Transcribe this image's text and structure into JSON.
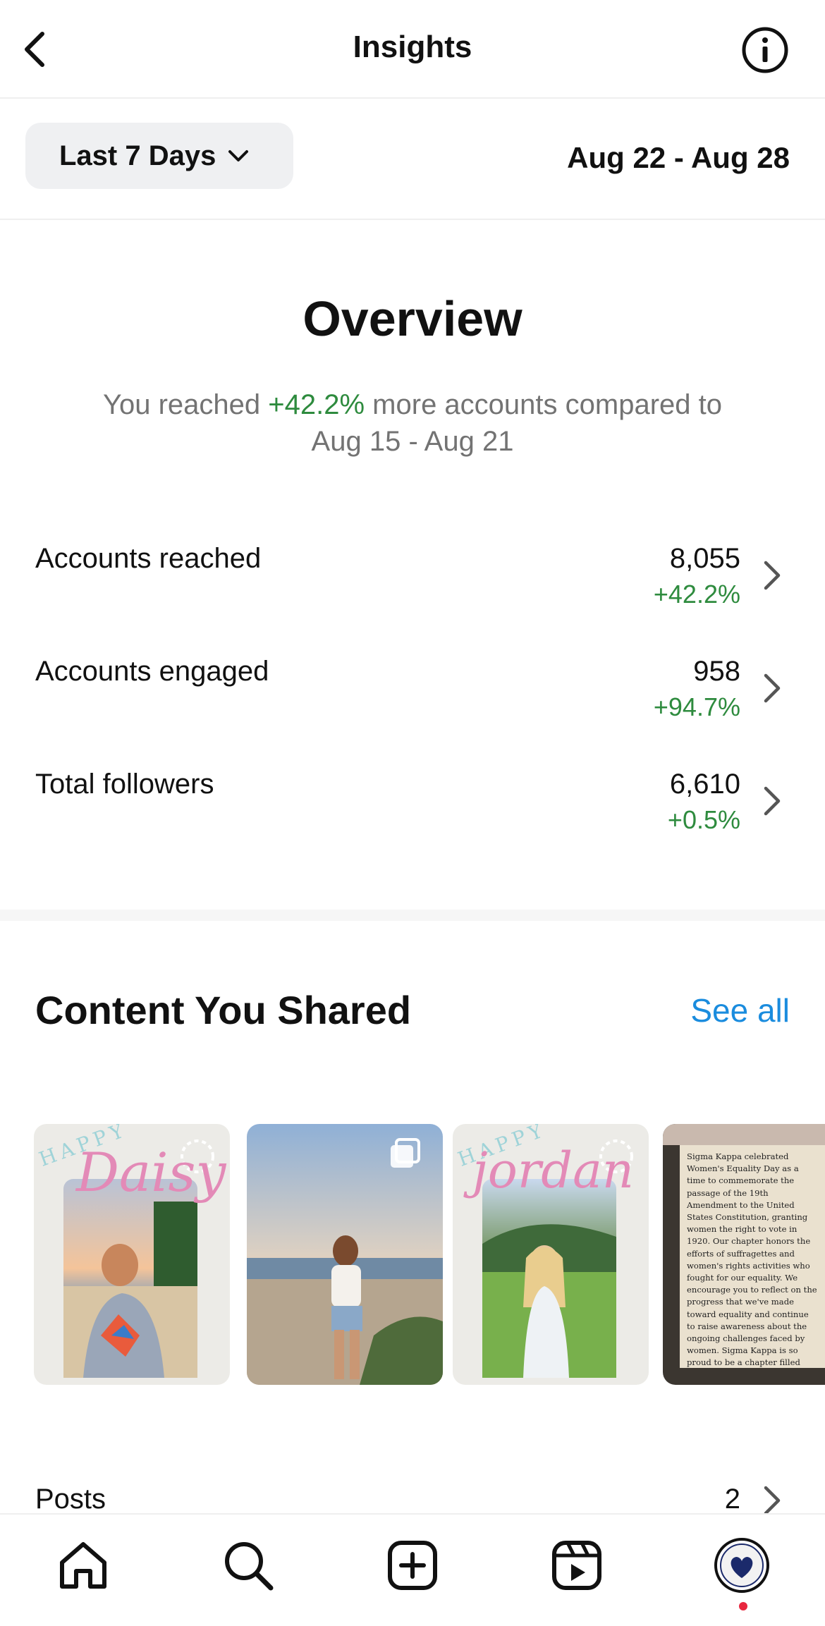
{
  "header": {
    "title": "Insights"
  },
  "filter": {
    "range_label": "Last 7 Days",
    "date_range": "Aug 22 - Aug 28"
  },
  "overview": {
    "title": "Overview",
    "sub_prefix": "You reached ",
    "sub_change": "+42.2%",
    "sub_suffix": " more accounts compared to Aug 15 - Aug 21"
  },
  "metrics": [
    {
      "label": "Accounts reached",
      "value": "8,055",
      "change": "+42.2%"
    },
    {
      "label": "Accounts engaged",
      "value": "958",
      "change": "+94.7%"
    },
    {
      "label": "Total followers",
      "value": "6,610",
      "change": "+0.5%"
    }
  ],
  "content": {
    "title": "Content You Shared",
    "see_all": "See all",
    "thumbnails": [
      {
        "name": "Daisy"
      },
      {
        "name": ""
      },
      {
        "name": "jordan"
      },
      {
        "text": "Sigma Kappa celebrated Women's Equality Day as a time to commemorate the passage of the 19th Amendment to the United States Constitution, granting women the right to vote in 1920. Our chapter honors the efforts of suffragettes and women's rights activities who fought for our equality. We encourage you to reflect on the progress that we've made toward equality and continue to raise awareness about the ongoing challenges faced by women. Sigma Kappa is so proud to be a chapter filled with strong, empowered, brilliant women that will continue to strive for a more inclusive and equitable society for everyone!"
      }
    ]
  },
  "posts": {
    "label": "Posts",
    "value": "2"
  },
  "colors": {
    "green": "#2e8b3e",
    "link": "#1a8cde",
    "badge": "#e8273f"
  }
}
